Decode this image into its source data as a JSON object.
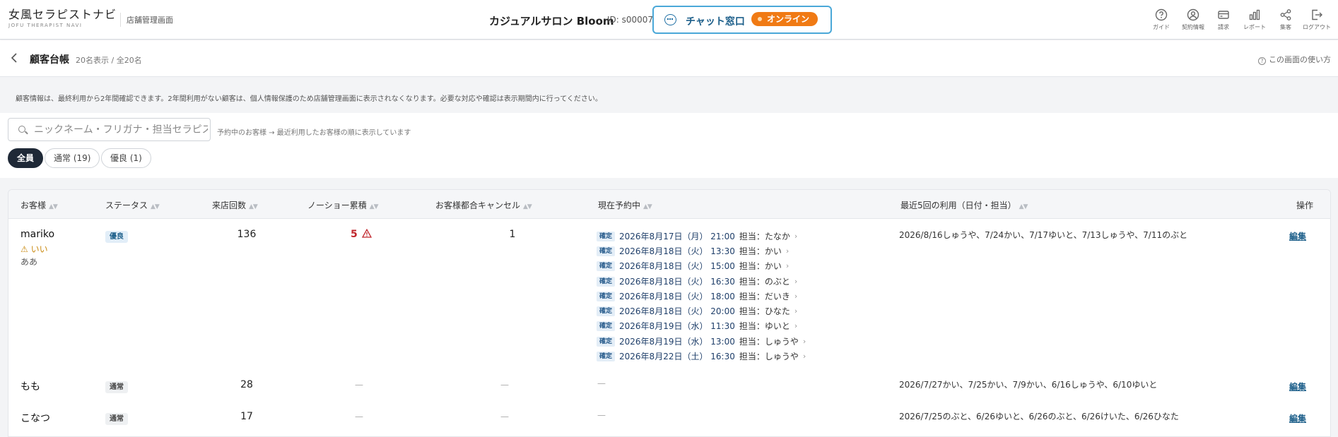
{
  "header": {
    "brand_name": "女風セラピストナビ",
    "brand_sub": "JOFU THERAPIST NAVI",
    "brand_admin": "店舗管理画面",
    "shop_name": "カジュアルサロン Bloom",
    "shop_id": "ID: s00007",
    "chat_label": "チャット窓口",
    "online_label": "オンライン",
    "nav": [
      {
        "label": "ガイド",
        "icon": "help-circle-icon"
      },
      {
        "label": "契約情報",
        "icon": "user-circle-icon"
      },
      {
        "label": "請求",
        "icon": "card-icon"
      },
      {
        "label": "レポート",
        "icon": "bar-chart-icon"
      },
      {
        "label": "集客",
        "icon": "share-icon"
      },
      {
        "label": "ログアウト",
        "icon": "logout-icon"
      }
    ]
  },
  "page": {
    "title": "顧客台帳",
    "count": "20名表示 / 全20名",
    "howto": "この画面の使い方",
    "notice": "顧客情報は、最終利用から2年間確認できます。2年間利用がない顧客は、個人情報保護のため店舗管理画面に表示されなくなります。必要な対応や確認は表示期間内に行ってください。"
  },
  "search": {
    "placeholder": "ニックネーム・フリガナ・担当セラピスト",
    "hint": "予約中のお客様 → 最近利用したお客様の順に表示しています"
  },
  "filters": [
    {
      "label": "全員",
      "active": true
    },
    {
      "label": "通常 (19)",
      "active": false
    },
    {
      "label": "優良 (1)",
      "active": false
    }
  ],
  "table": {
    "columns": {
      "customer": "お客様",
      "status": "ステータス",
      "visits": "来店回数",
      "noshow": "ノーショー累積",
      "cancel": "お客様都合キャンセル",
      "current": "現在予約中",
      "recent": "最近5回の利用（日付・担当）",
      "action": "操作"
    },
    "rows": [
      {
        "name": "mariko",
        "warn": "⚠ いい",
        "note": "ああ",
        "status": "優良",
        "visits": "136",
        "noshow": "5",
        "cancel": "1",
        "reservations": [
          {
            "tag": "確定",
            "date": "2026年8月17日（月） 21:00",
            "staff": "担当：たなか"
          },
          {
            "tag": "確定",
            "date": "2026年8月18日（火） 13:30",
            "staff": "担当：かい"
          },
          {
            "tag": "確定",
            "date": "2026年8月18日（火） 15:00",
            "staff": "担当：かい"
          },
          {
            "tag": "確定",
            "date": "2026年8月18日（火） 16:30",
            "staff": "担当：のぶと"
          },
          {
            "tag": "確定",
            "date": "2026年8月18日（火） 18:00",
            "staff": "担当：だいき"
          },
          {
            "tag": "確定",
            "date": "2026年8月18日（火） 20:00",
            "staff": "担当：ひなた"
          },
          {
            "tag": "確定",
            "date": "2026年8月19日（水） 11:30",
            "staff": "担当：ゆいと"
          },
          {
            "tag": "確定",
            "date": "2026年8月19日（水） 13:00",
            "staff": "担当：しゅうや"
          },
          {
            "tag": "確定",
            "date": "2026年8月22日（土） 16:30",
            "staff": "担当：しゅうや"
          }
        ],
        "recent": "2026/8/16しゅうや、7/24かい、7/17ゆいと、7/13しゅうや、7/11のぶと",
        "action": "編集"
      },
      {
        "name": "もも",
        "status": "通常",
        "visits": "28",
        "noshow": "—",
        "cancel": "—",
        "current": "—",
        "recent": "2026/7/27かい、7/25かい、7/9かい、6/16しゅうや、6/10ゆいと",
        "action": "編集"
      },
      {
        "name": "こなつ",
        "status": "通常",
        "visits": "17",
        "noshow": "—",
        "cancel": "—",
        "current": "—",
        "recent": "2026/7/25のぶと、6/26ゆいと、6/26のぶと、6/26けいた、6/26ひなた",
        "action": "編集"
      }
    ]
  },
  "colors": {
    "accent": "#1d5f8a",
    "online": "#f07a14",
    "warning": "#c98a10",
    "danger": "#c0262d",
    "dark_pill": "#1f2937"
  }
}
